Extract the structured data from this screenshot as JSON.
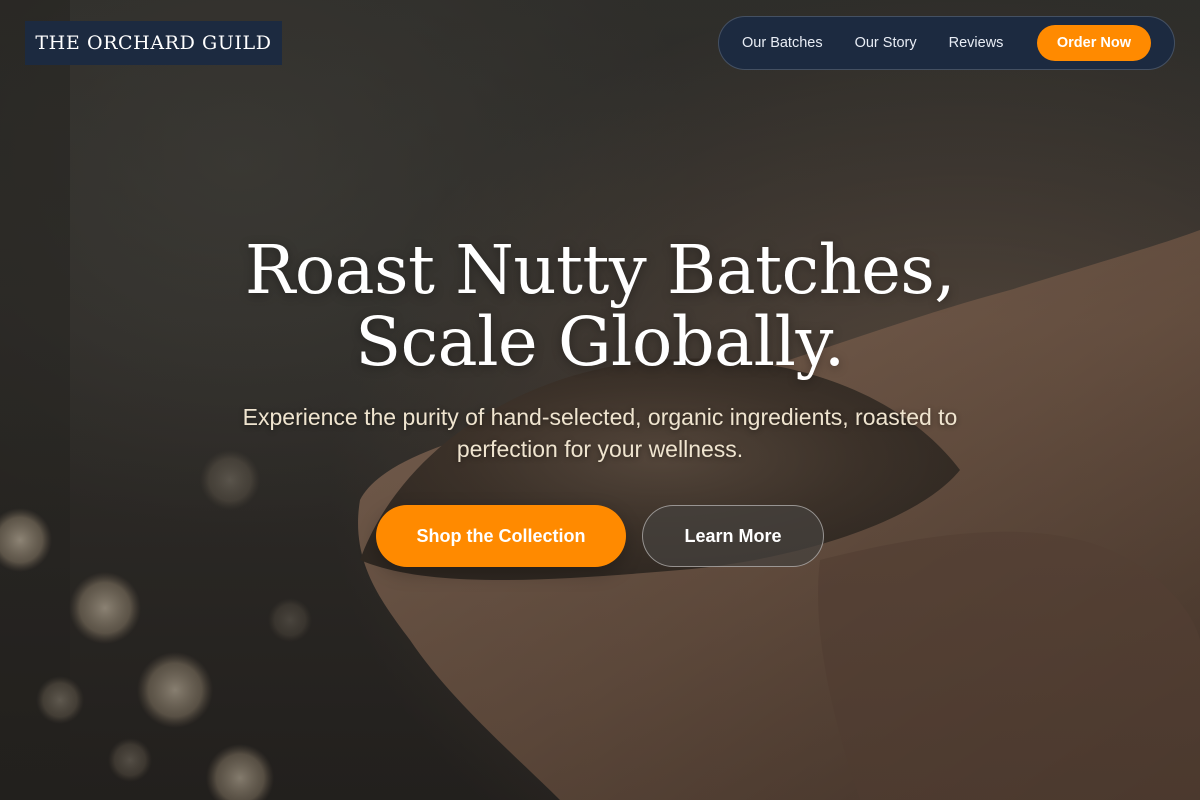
{
  "brand": {
    "name": "THE ORCHARD GUILD"
  },
  "nav": {
    "links": [
      "Our Batches",
      "Our Story",
      "Reviews"
    ],
    "cta_label": "Order Now"
  },
  "hero": {
    "title": "Roast Nutty Batches, Scale Globally.",
    "subtitle": "Experience the purity of hand-selected, organic ingredients, roasted to perfection for your wellness.",
    "primary_button": "Shop the Collection",
    "secondary_button": "Learn More",
    "background_image": "hands-holding-soil"
  },
  "colors": {
    "accent": "#ff8a00",
    "nav_bg": "#1c2a40",
    "subtitle_text": "#efe4cf"
  }
}
